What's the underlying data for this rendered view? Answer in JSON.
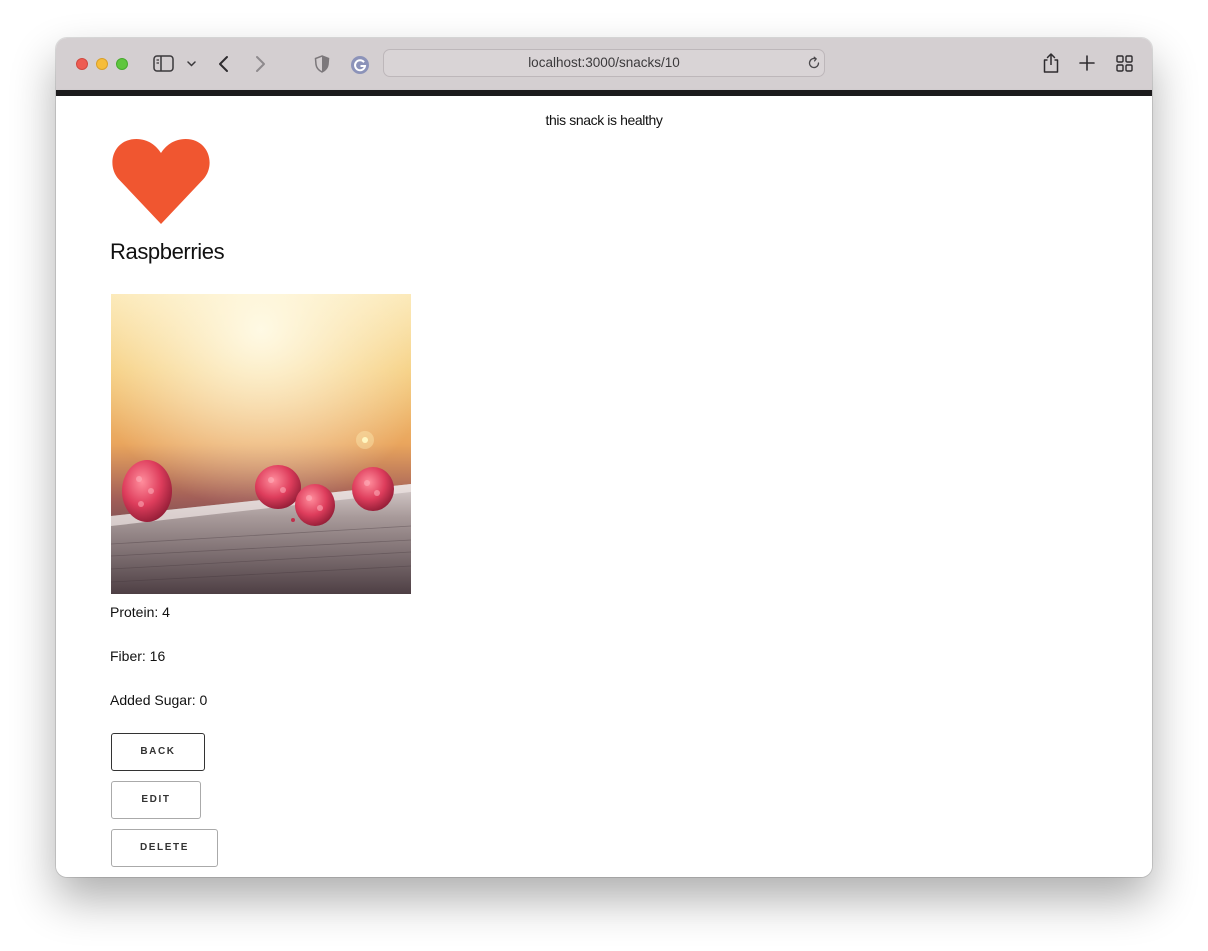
{
  "browser": {
    "url": "localhost:3000/snacks/10"
  },
  "page": {
    "header_text": "this snack is healthy",
    "heart_color": "#f05630",
    "snack_name": "Raspberries",
    "photo_alt": "Raspberries",
    "nutrition": {
      "protein": "Protein: 4",
      "fiber": "Fiber: 16",
      "added_sugar": "Added Sugar: 0"
    },
    "buttons": {
      "back": "BACK",
      "edit": "EDIT",
      "delete": "DELETE"
    }
  }
}
